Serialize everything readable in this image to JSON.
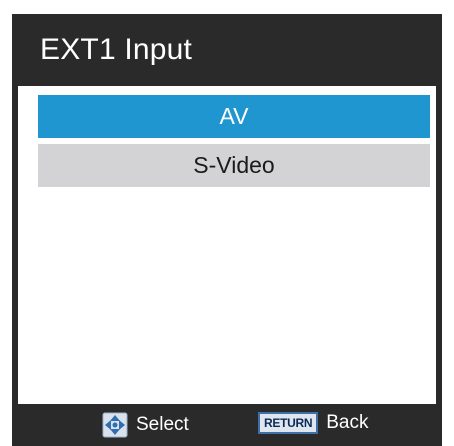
{
  "menu": {
    "title": "EXT1 Input"
  },
  "options": [
    {
      "label": "AV",
      "selected": true
    },
    {
      "label": "S-Video",
      "selected": false
    }
  ],
  "footer": {
    "select_icon": "dpad-icon",
    "select_label": "Select",
    "return_key_label": "RETURN",
    "back_label": "Back"
  },
  "colors": {
    "frame": "#2a2a2a",
    "selected_bg": "#1f96cf",
    "option_bg": "#d3d3d5"
  }
}
